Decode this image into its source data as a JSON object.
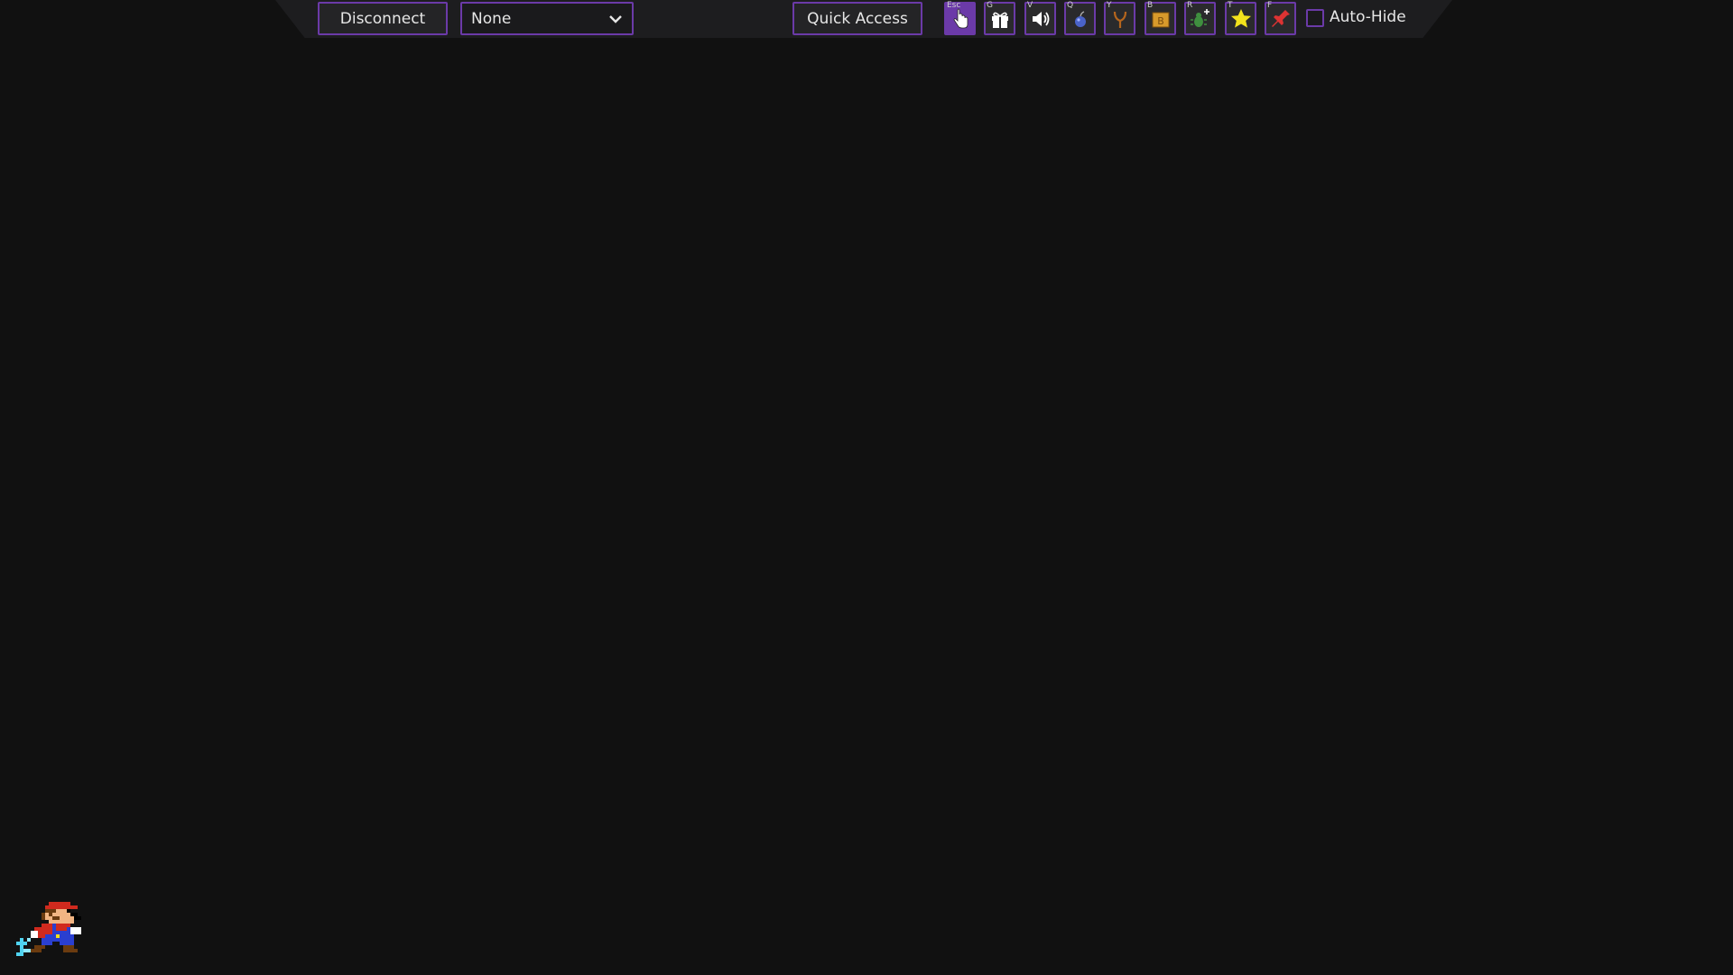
{
  "toolbar": {
    "disconnect_label": "Disconnect",
    "dropdown_value": "None",
    "quick_access_label": "Quick Access",
    "autohide_label": "Auto-Hide",
    "tools": [
      {
        "key": "Esc",
        "icon": "pointer-hand-icon",
        "active": true
      },
      {
        "key": "G",
        "icon": "gift-icon",
        "active": false
      },
      {
        "key": "V",
        "icon": "speaker-icon",
        "active": false
      },
      {
        "key": "Q",
        "icon": "bomb-icon",
        "active": false
      },
      {
        "key": "Y",
        "icon": "slingshot-icon",
        "active": false
      },
      {
        "key": "B",
        "icon": "b-block-icon",
        "active": false
      },
      {
        "key": "R",
        "icon": "bug-plus-icon",
        "active": false
      },
      {
        "key": "T",
        "icon": "star-icon",
        "active": false
      },
      {
        "key": "F",
        "icon": "pin-icon",
        "active": false
      }
    ]
  },
  "colors": {
    "accent": "#6b3aa8",
    "background": "#111111",
    "toolbar": "#1d1d1f"
  }
}
